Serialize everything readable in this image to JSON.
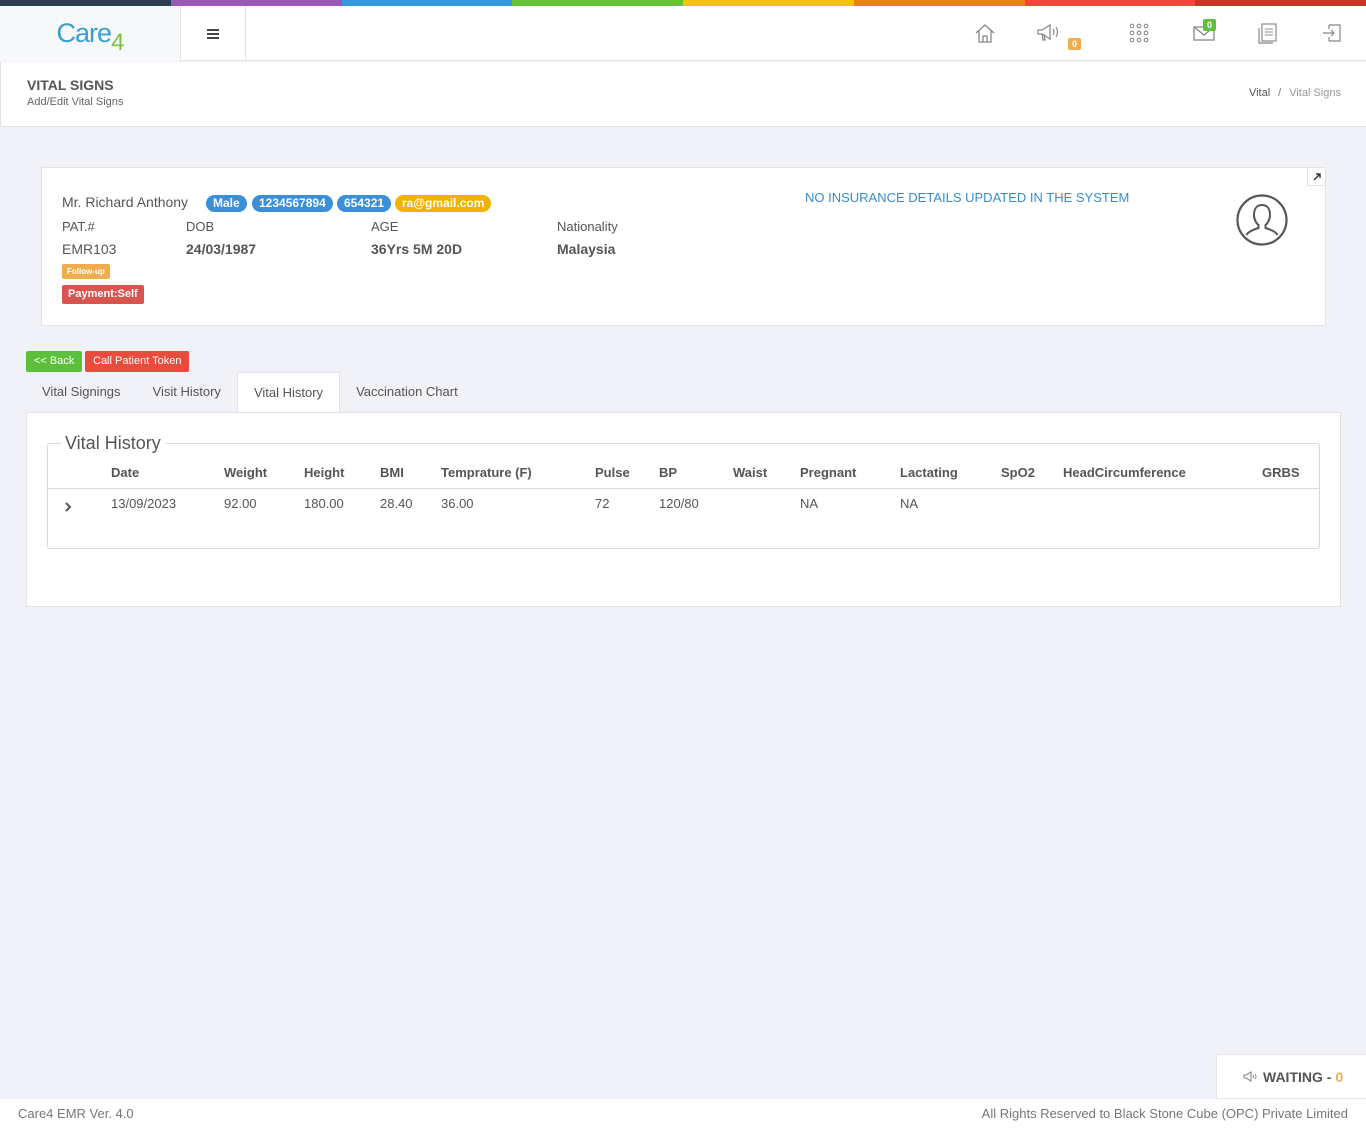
{
  "colors": {
    "strip": [
      "#2c3e50",
      "#9b59b6",
      "#3498db",
      "#66c23a",
      "#f1c40f",
      "#e67e22",
      "#e74c3c",
      "#c0392b"
    ],
    "male_pill": "#3a8fd8",
    "id_pill": "#3a8fd8",
    "email_pill": "#f0b400",
    "followup": "#f0ad4e",
    "payment": "#d9534f",
    "back_btn": "#5cc03c",
    "token_btn": "#e74c3c"
  },
  "header": {
    "logo_text": "Care",
    "logo_suffix": "4",
    "icons": [
      "home-icon",
      "megaphone-icon",
      "grid-icon",
      "mail-icon",
      "document-icon",
      "logout-icon"
    ],
    "announcement_count": "0",
    "mail_count": "0"
  },
  "page": {
    "title": "VITAL SIGNS",
    "subtitle": "Add/Edit Vital Signs",
    "breadcrumb": [
      "Vital",
      "Vital Signs"
    ]
  },
  "patient": {
    "name": "Mr. Richard Anthony",
    "gender": "Male",
    "phone": "1234567894",
    "code": "654321",
    "email": "ra@gmail.com",
    "labels": {
      "pat": "PAT.#",
      "dob": "DOB",
      "age": "AGE",
      "nationality": "Nationality"
    },
    "values": {
      "pat": "EMR103",
      "dob": "24/03/1987",
      "age": "36Yrs 5M 20D",
      "nationality": "Malaysia"
    },
    "followup": "Follow-up",
    "payment": "Payment:Self",
    "insurance": "NO INSURANCE DETAILS UPDATED IN THE SYSTEM"
  },
  "actions": {
    "back": "<< Back",
    "call_token": "Call Patient Token"
  },
  "tabs": [
    {
      "label": "Vital Signings",
      "active": false
    },
    {
      "label": "Visit History",
      "active": false
    },
    {
      "label": "Vital History",
      "active": true
    },
    {
      "label": "Vaccination Chart",
      "active": false
    }
  ],
  "vital_history": {
    "legend": "Vital History",
    "columns": [
      "Date",
      "Weight",
      "Height",
      "BMI",
      "Temprature (F)",
      "Pulse",
      "BP",
      "Waist",
      "Pregnant",
      "Lactating",
      "SpO2",
      "HeadCircumference",
      "GRBS"
    ],
    "rows": [
      [
        "13/09/2023",
        "92.00",
        "180.00",
        "28.40",
        "36.00",
        "72",
        "120/80",
        "",
        "NA",
        "NA",
        "",
        "",
        ""
      ]
    ]
  },
  "waiting": {
    "label": "WAITING -",
    "count": "0"
  },
  "footer": {
    "version": "Care4 EMR Ver. 4.0",
    "rights": "All Rights Reserved to Black Stone Cube (OPC) Private Limited"
  }
}
